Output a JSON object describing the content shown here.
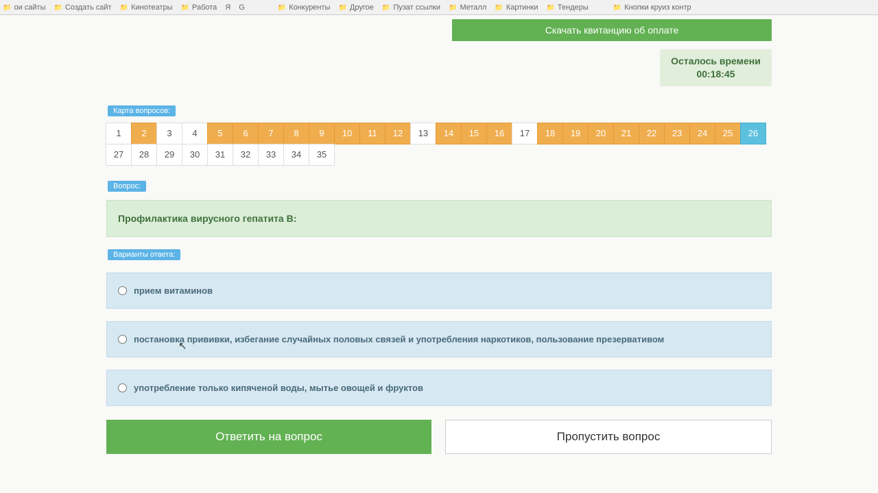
{
  "bookmarks": [
    "ои сайты",
    "Создать сайт",
    "Кинотеатры",
    "Работа",
    "Я",
    "G",
    "",
    "",
    "",
    "Конкуренты",
    "Другое",
    "Пузат ссылки",
    "Металл",
    "Картинки",
    "Тендеры",
    "",
    "",
    "Кнопки круиз контр"
  ],
  "download_label": "Скачать квитанцию об оплате",
  "timer": {
    "label": "Осталось времени",
    "value": "00:18:45"
  },
  "labels": {
    "qmap": "Карта вопросов:",
    "question": "Вопрос:",
    "answers": "Варианты ответа:"
  },
  "qmap": [
    {
      "n": "1",
      "s": "plain"
    },
    {
      "n": "2",
      "s": "orange"
    },
    {
      "n": "3",
      "s": "plain"
    },
    {
      "n": "4",
      "s": "plain"
    },
    {
      "n": "5",
      "s": "orange"
    },
    {
      "n": "6",
      "s": "orange"
    },
    {
      "n": "7",
      "s": "orange"
    },
    {
      "n": "8",
      "s": "orange"
    },
    {
      "n": "9",
      "s": "orange"
    },
    {
      "n": "10",
      "s": "orange"
    },
    {
      "n": "11",
      "s": "orange"
    },
    {
      "n": "12",
      "s": "orange"
    },
    {
      "n": "13",
      "s": "plain"
    },
    {
      "n": "14",
      "s": "orange"
    },
    {
      "n": "15",
      "s": "orange"
    },
    {
      "n": "16",
      "s": "orange"
    },
    {
      "n": "17",
      "s": "plain"
    },
    {
      "n": "18",
      "s": "orange"
    },
    {
      "n": "19",
      "s": "orange"
    },
    {
      "n": "20",
      "s": "orange"
    },
    {
      "n": "21",
      "s": "orange"
    },
    {
      "n": "22",
      "s": "orange"
    },
    {
      "n": "23",
      "s": "orange"
    },
    {
      "n": "24",
      "s": "orange"
    },
    {
      "n": "25",
      "s": "orange"
    },
    {
      "n": "26",
      "s": "blue"
    },
    {
      "n": "27",
      "s": "plain"
    },
    {
      "n": "28",
      "s": "plain"
    },
    {
      "n": "29",
      "s": "plain"
    },
    {
      "n": "30",
      "s": "plain"
    },
    {
      "n": "31",
      "s": "plain"
    },
    {
      "n": "32",
      "s": "plain"
    },
    {
      "n": "33",
      "s": "plain"
    },
    {
      "n": "34",
      "s": "plain"
    },
    {
      "n": "35",
      "s": "plain"
    }
  ],
  "question_text": "Профилактика вирусного гепатита В:",
  "answers": [
    "прием витаминов",
    "постановка прививки, избегание случайных половых связей и употребления наркотиков, пользование презервативом",
    "употребление только кипяченой воды, мытье овощей и фруктов"
  ],
  "buttons": {
    "answer": "Ответить на вопрос",
    "skip": "Пропустить вопрос"
  }
}
